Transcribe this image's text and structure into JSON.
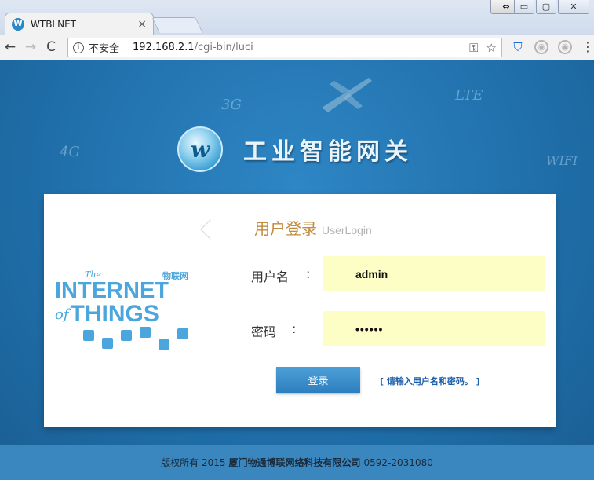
{
  "browser": {
    "tab_title": "WTBLNET",
    "tab_favicon": "W",
    "tab_close": "×",
    "window_buttons": {
      "ext": "⇔",
      "minimize": "▭",
      "maximize": "▢",
      "close": "✕"
    },
    "nav": {
      "back": "←",
      "forward": "→",
      "reload": "C"
    },
    "security_label": "不安全",
    "url_host": "192.168.2.1",
    "url_path": "/cgi-bin/luci",
    "icons": [
      "key-icon",
      "star-icon",
      "shield-extension-icon",
      "extension-icon",
      "extension-icon",
      "menu-icon"
    ]
  },
  "background_words": {
    "g3": "3G",
    "g4": "4G",
    "lte": "LTE",
    "wifi": "WIFI"
  },
  "header": {
    "logo_letter": "w",
    "title": "工业智能网关"
  },
  "illustration": {
    "the": "The",
    "cn": "物联网",
    "internet": "INTERNET",
    "of": "of",
    "things": "THINGS"
  },
  "login": {
    "title": "用户登录",
    "title_en": "UserLogin",
    "username_label": "用户名",
    "password_label": "密码",
    "colon": ":",
    "username_value": "admin",
    "password_value": "••••••",
    "submit_label": "登录",
    "hint": "[ 请输入用户名和密码。 ]"
  },
  "footer": {
    "prefix": "版权所有 2015",
    "company": "厦门物通博联网络科技有限公司",
    "phone": "0592-2031080"
  },
  "colors": {
    "page_bg": "#1f6ea9",
    "input_bg": "#fcfec5",
    "title_accent": "#c38a3e",
    "button": "#3a8ccb"
  }
}
